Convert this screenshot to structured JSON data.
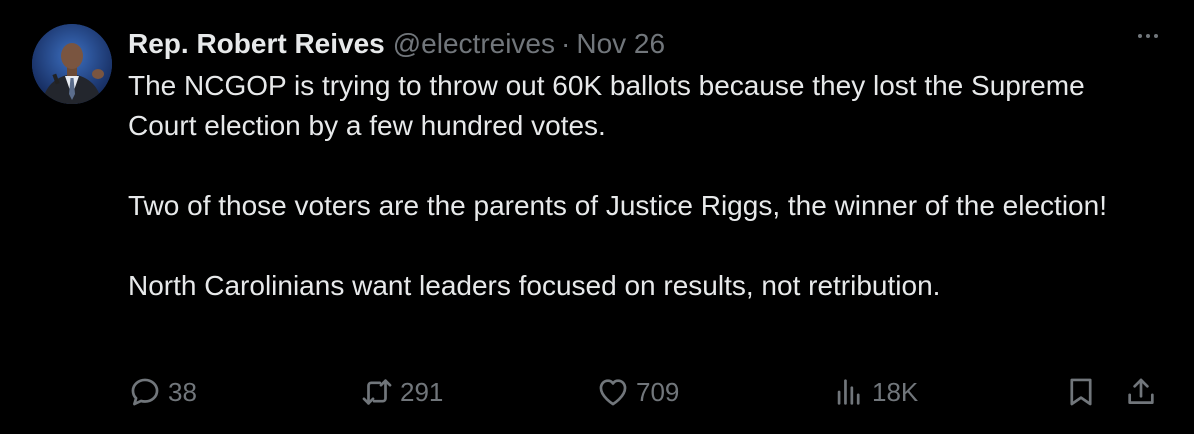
{
  "author": {
    "name": "Rep. Robert Reives",
    "handle": "@electreives",
    "separator": "·",
    "date": "Nov 26"
  },
  "tweet": {
    "paragraphs": [
      "The NCGOP is trying to throw out 60K ballots because they lost the Supreme Court election by a few hundred votes.",
      "Two of those voters are the parents of Justice Riggs, the winner of the election!",
      "North Carolinians want leaders focused on results, not retribution."
    ]
  },
  "stats": {
    "replies": "38",
    "retweets": "291",
    "likes": "709",
    "views": "18K"
  },
  "icons": {
    "reply": "reply-icon",
    "retweet": "retweet-icon",
    "like": "heart-icon",
    "views": "views-icon",
    "bookmark": "bookmark-icon",
    "share": "share-icon",
    "more": "more-icon"
  },
  "colors": {
    "background": "#000000",
    "text_primary": "#e7e9ea",
    "text_secondary": "#71767b"
  }
}
